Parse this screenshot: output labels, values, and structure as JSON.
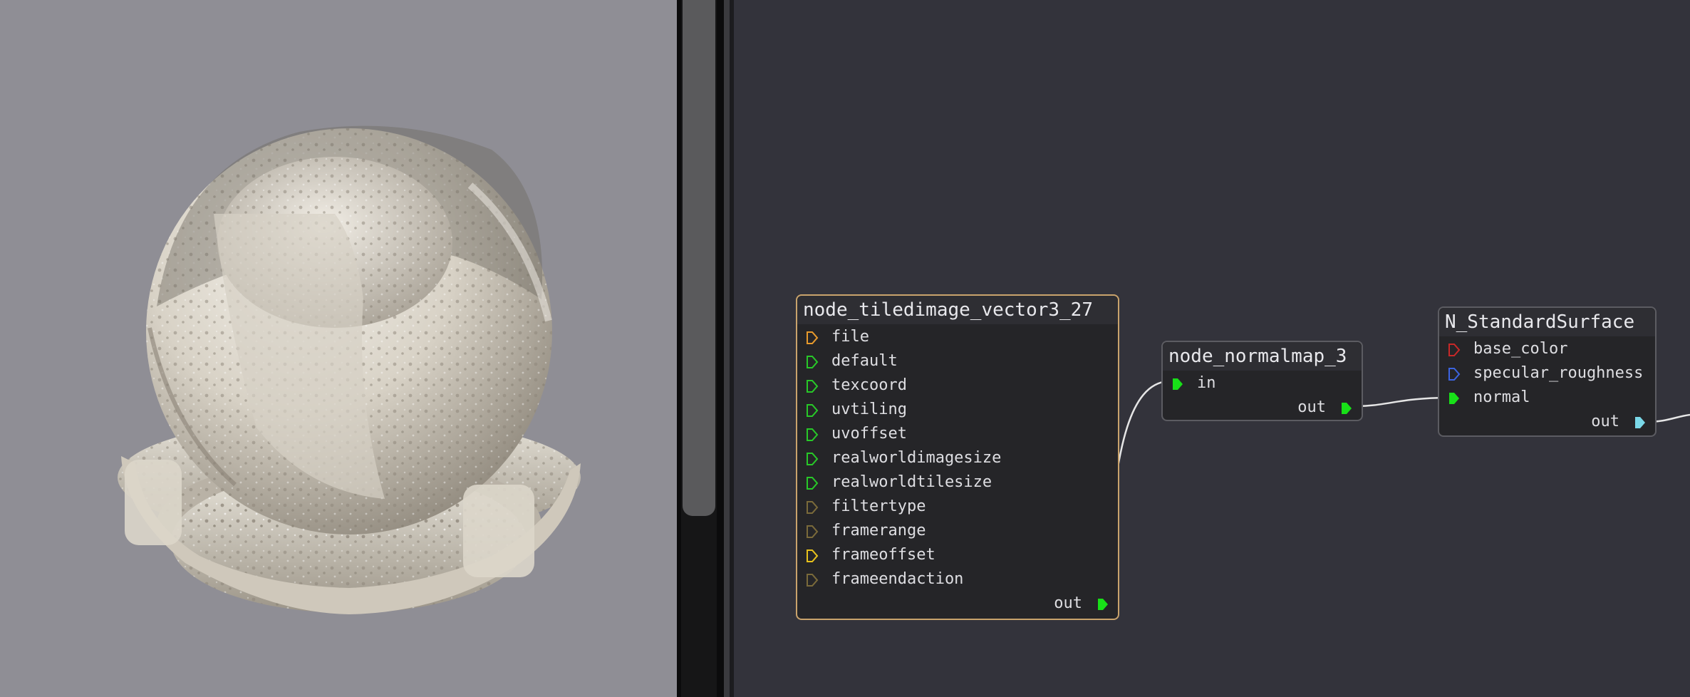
{
  "viewport": {
    "label": "material-preview",
    "background": "#8f8e95"
  },
  "graph": {
    "nodes": [
      {
        "id": "node_tiledimage_vector3_27",
        "title": "node_tiledimage_vector3_27",
        "selected": true,
        "inputs": [
          {
            "label": "file",
            "color": "#e89a2c"
          },
          {
            "label": "default",
            "color": "#28c828"
          },
          {
            "label": "texcoord",
            "color": "#28c828"
          },
          {
            "label": "uvtiling",
            "color": "#28c828"
          },
          {
            "label": "uvoffset",
            "color": "#28c828"
          },
          {
            "label": "realworldimagesize",
            "color": "#28c828"
          },
          {
            "label": "realworldtilesize",
            "color": "#28c828"
          },
          {
            "label": "filtertype",
            "color": "#7a6a3a"
          },
          {
            "label": "framerange",
            "color": "#7a6a3a"
          },
          {
            "label": "frameoffset",
            "color": "#e8c21c"
          },
          {
            "label": "frameendaction",
            "color": "#7a6a3a"
          }
        ],
        "output": {
          "label": "out",
          "color": "#18e018"
        }
      },
      {
        "id": "node_normalmap_3",
        "title": "node_normalmap_3",
        "selected": false,
        "inputs": [
          {
            "label": "in",
            "color": "#18e018",
            "connected": true
          }
        ],
        "output": {
          "label": "out",
          "color": "#18e018"
        }
      },
      {
        "id": "N_StandardSurface",
        "title": "N_StandardSurface",
        "selected": false,
        "inputs": [
          {
            "label": "base_color",
            "color": "#c82828"
          },
          {
            "label": "specular_roughness",
            "color": "#3c64e0"
          },
          {
            "label": "normal",
            "color": "#18e018",
            "connected": true
          }
        ],
        "output": {
          "label": "out",
          "color": "#7ad8e8"
        }
      }
    ]
  }
}
